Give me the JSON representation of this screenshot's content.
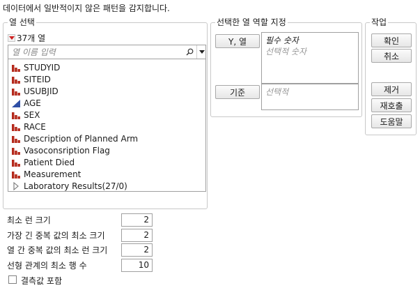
{
  "instruction": "데이터에서 일반적이지 않은 패턴을 감지합니다.",
  "column_select": {
    "title": "열 선택",
    "count_label": "37개 열",
    "search_placeholder": "열 이름 입력",
    "columns": [
      {
        "label": "STUDYID",
        "icon": "nominal-bar-icon"
      },
      {
        "label": "SITEID",
        "icon": "nominal-bar-icon"
      },
      {
        "label": "USUBJID",
        "icon": "nominal-bar-icon"
      },
      {
        "label": "AGE",
        "icon": "continuous-triangle-icon"
      },
      {
        "label": "SEX",
        "icon": "nominal-bar-icon"
      },
      {
        "label": "RACE",
        "icon": "nominal-bar-icon"
      },
      {
        "label": "Description of Planned Arm",
        "icon": "nominal-bar-icon"
      },
      {
        "label": "Vasoconsription Flag",
        "icon": "nominal-bar-icon"
      },
      {
        "label": "Patient Died",
        "icon": "nominal-bar-icon"
      },
      {
        "label": "Measurement",
        "icon": "nominal-bar-icon"
      },
      {
        "label": "Laboratory Results(27/0)",
        "icon": "expand-triangle-icon"
      }
    ]
  },
  "roles": {
    "title": "선택한 열 역할 지정",
    "y_button": "Y, 열",
    "y_required": "필수 숫자",
    "y_optional": "선택적 숫자",
    "by_button": "기준",
    "by_optional": "선택적"
  },
  "actions": {
    "title": "작업",
    "ok": "확인",
    "cancel": "취소",
    "remove": "제거",
    "recall": "재호출",
    "help": "도움말"
  },
  "options": [
    {
      "label": "최소 런 크기",
      "value": "2"
    },
    {
      "label": "가장 긴 중복 값의 최소 크기",
      "value": "2"
    },
    {
      "label": "열 간 중복 값의 최소 런 크기",
      "value": "2"
    },
    {
      "label": "선형 관계의 최소 행 수",
      "value": "10"
    }
  ],
  "include_missing_label": "결측값 포함",
  "colors": {
    "nominal_icon": "#b52a1c",
    "continuous_icon": "#2f4fa6",
    "dropdown_red": "#d02020"
  }
}
